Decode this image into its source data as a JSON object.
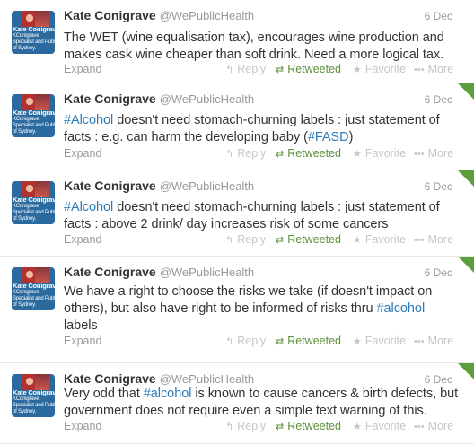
{
  "tweets": [
    {
      "name": "Kate Conigrave",
      "handle": "@WePublicHealth",
      "date": "6 Dec",
      "text_parts": [
        "The WET (wine equalisation tax), encourages wine production and makes cask wine cheaper than soft drink. Need a more logical tax."
      ]
    },
    {
      "name": "Kate Conigrave",
      "handle": "@WePublicHealth",
      "date": "6 Dec",
      "tag1": "#Alcohol",
      "text_mid": " doesn't need stomach-churning labels : just statement of facts : e.g. can harm the developing baby (",
      "tag2": "#FASD",
      "text_end": ")"
    },
    {
      "name": "Kate Conigrave",
      "handle": "@WePublicHealth",
      "date": "6 Dec",
      "tag1": "#Alcohol",
      "text_mid": " doesn't need stomach-churning labels : just statement of facts : above 2  drink/ day increases risk of some cancers"
    },
    {
      "name": "Kate Conigrave",
      "handle": "@WePublicHealth",
      "date": "6 Dec",
      "text_start": "We have a right to choose the risks we take (if doesn't impact on others), but also have right to be informed of risks thru  ",
      "tag1": "#alcohol",
      "text_end": " labels"
    },
    {
      "name": "Kate Conigrave",
      "handle": "@WePublicHealth",
      "date": "6 Dec",
      "text_start": "Very odd that ",
      "tag1": "#alcohol",
      "text_end": " is known to cause cancers & birth defects, but government does not require even a simple text warning of this."
    }
  ],
  "avatar": {
    "line1": "Kate Conigrave",
    "line2": "KConigrave",
    "line3": "Specialist and Public Health",
    "line4": "of Sydney."
  },
  "actions": {
    "expand": "Expand",
    "reply": "Reply",
    "retweeted": "Retweeted",
    "favorite": "Favorite",
    "more": "More"
  },
  "icons": {
    "reply": "reply-arrow-icon",
    "retweet": "retweet-icon",
    "favorite": "star-icon",
    "more": "ellipsis-icon",
    "corner": "retweeted-corner-icon"
  },
  "colors": {
    "link": "#2b7bb9",
    "retweet": "#5c913b",
    "muted": "#999999"
  }
}
